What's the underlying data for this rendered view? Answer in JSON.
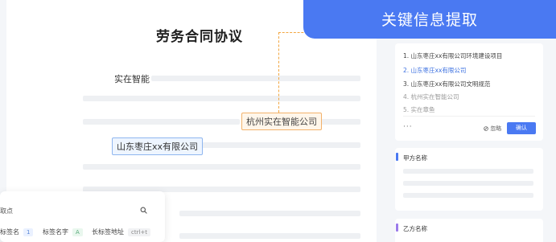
{
  "document": {
    "title": "劳务合同协议",
    "party_label": "实在智能",
    "tag_orange": "杭州实在智能公司",
    "tag_blue": "山东枣庄xx有限公司"
  },
  "tag_panel": {
    "header": "取点",
    "tags": [
      {
        "label": "标签名",
        "chip": "1"
      },
      {
        "label": "标签名字",
        "chip": "A"
      },
      {
        "label": "长标签地址",
        "chip": "ctrl+t"
      }
    ]
  },
  "banner": {
    "title": "关键信息提取"
  },
  "extraction": {
    "items": [
      "1. 山东枣庄xx有限公司环境建设项目",
      "2. 山东枣庄xx有限公司",
      "3. 山东枣庄xx有限公司文明规范",
      "4. 杭州实在智能公司",
      "5. 实在章鱼"
    ],
    "more_label": "···",
    "ignore_label": "忽略",
    "confirm_label": "确认"
  },
  "sections": [
    {
      "title": "甲方名称",
      "color": "#4a79f2"
    },
    {
      "title": "乙方名称",
      "color": "#9b7bea"
    }
  ],
  "colors": {
    "accent": "#4a79f2",
    "highlight_orange": "#f2a640",
    "highlight_blue": "#8fb6ef"
  }
}
